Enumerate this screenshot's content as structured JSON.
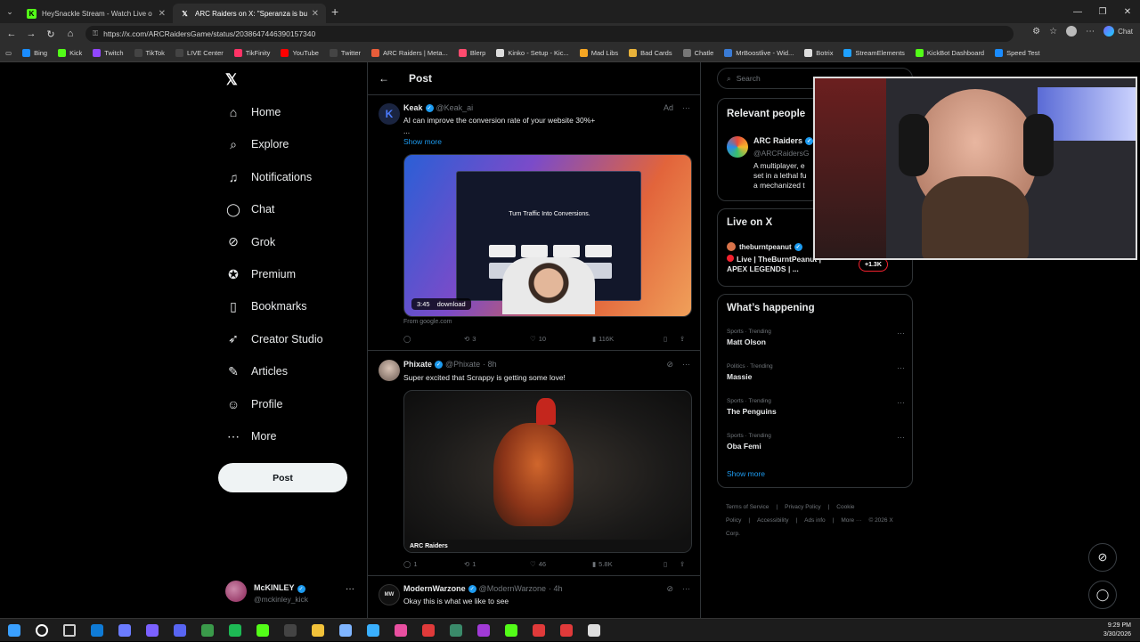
{
  "browser": {
    "tabs": [
      {
        "title": "HeySnackle Stream - Watch Live o",
        "icon": "kick-icon",
        "color": "#53fc18",
        "active": false
      },
      {
        "title": "ARC Raiders on X: \"Speranza is bu",
        "icon": "x-icon",
        "color": "#ffffff",
        "active": true
      }
    ],
    "url": "https://x.com/ARCRaidersGame/status/2038647446390157340",
    "chat_label": "Chat",
    "bookmarks": [
      {
        "label": "Bing",
        "color": "#1a8cff"
      },
      {
        "label": "Kick",
        "color": "#53fc18"
      },
      {
        "label": "Twitch",
        "color": "#9146ff"
      },
      {
        "label": "TikTok",
        "color": "#444444"
      },
      {
        "label": "LIVE Center",
        "color": "#444444"
      },
      {
        "label": "TikFinity",
        "color": "#ff3366"
      },
      {
        "label": "YouTube",
        "color": "#ff0000"
      },
      {
        "label": "Twitter",
        "color": "#444444"
      },
      {
        "label": "ARC Raiders | Meta...",
        "color": "#e85d3a"
      },
      {
        "label": "Blerp",
        "color": "#ff4b6e"
      },
      {
        "label": "Kinko - Setup - Kic...",
        "color": "#dddddd"
      },
      {
        "label": "Mad Libs",
        "color": "#f5a623"
      },
      {
        "label": "Bad Cards",
        "color": "#e8b23a"
      },
      {
        "label": "Chatle",
        "color": "#777777"
      },
      {
        "label": "MrBoostlive - Wid...",
        "color": "#3a7bd5"
      },
      {
        "label": "Botrix",
        "color": "#dddddd"
      },
      {
        "label": "StreamElements",
        "color": "#1ea0ff"
      },
      {
        "label": "KickBot Dashboard",
        "color": "#53fc18"
      },
      {
        "label": "Speed Test",
        "color": "#1a8cff"
      }
    ]
  },
  "nav": {
    "items": [
      {
        "label": "Home",
        "icon": "home-icon",
        "glyph": "⌂"
      },
      {
        "label": "Explore",
        "icon": "search-icon",
        "glyph": "⌕"
      },
      {
        "label": "Notifications",
        "icon": "bell-icon",
        "glyph": "♫"
      },
      {
        "label": "Chat",
        "icon": "chat-icon",
        "glyph": "◯"
      },
      {
        "label": "Grok",
        "icon": "grok-icon",
        "glyph": "⊘"
      },
      {
        "label": "Premium",
        "icon": "premium-icon",
        "glyph": "✪"
      },
      {
        "label": "Bookmarks",
        "icon": "bookmark-icon",
        "glyph": "▯"
      },
      {
        "label": "Creator Studio",
        "icon": "rocket-icon",
        "glyph": "➶"
      },
      {
        "label": "Articles",
        "icon": "article-icon",
        "glyph": "✎"
      },
      {
        "label": "Profile",
        "icon": "profile-icon",
        "glyph": "☺"
      },
      {
        "label": "More",
        "icon": "more-icon",
        "glyph": "⋯"
      }
    ],
    "post_label": "Post",
    "me": {
      "name": "McKINLEY",
      "handle": "@mckinley_kick"
    }
  },
  "main": {
    "title": "Post",
    "tweets": [
      {
        "name": "Keak",
        "handle": "@Keak_ai",
        "meta": "",
        "ad": "Ad",
        "text": "AI can improve the conversion rate of your website 30%+",
        "ellipsis": "...",
        "show_more": "Show more",
        "video_title": "Turn Traffic Into Conversions.",
        "duration": "3:45",
        "video_action": "download",
        "source": "From google.com",
        "replies": "",
        "reposts": "3",
        "likes": "10",
        "views": "116K"
      },
      {
        "name": "Phixate",
        "handle": "@Phixate",
        "meta": "· 8h",
        "text": "Super excited that Scrappy is getting some love!",
        "watermark": "ARC Raiders",
        "replies": "1",
        "reposts": "1",
        "likes": "46",
        "views": "5.8K"
      },
      {
        "name": "ModernWarzone",
        "handle": "@ModernWarzone",
        "meta": "· 4h",
        "text": "Okay this is what we like to see"
      }
    ]
  },
  "sidebar": {
    "search_placeholder": "Search",
    "relevant": {
      "title": "Relevant people",
      "name": "ARC Raiders",
      "handle": "@ARCRaidersG",
      "bio1": "A multiplayer, e",
      "bio2": "set in a lethal fu",
      "bio3": "a mechanized t"
    },
    "live": {
      "title": "Live on X",
      "host": "theburntpeanut",
      "stream": "Live | TheBurntPeanut |",
      "stream2": "APEX LEGENDS | ...",
      "count": "+1.3K"
    },
    "happening": {
      "title": "What’s happening",
      "trends": [
        {
          "cat": "Sports · Trending",
          "name": "Matt Olson"
        },
        {
          "cat": "Politics · Trending",
          "name": "Massie"
        },
        {
          "cat": "Sports · Trending",
          "name": "The Penguins"
        },
        {
          "cat": "Sports · Trending",
          "name": "Oba Femi"
        }
      ],
      "show_more": "Show more"
    },
    "footer": [
      "Terms of Service",
      "|",
      "Privacy Policy",
      "|",
      "Cookie Policy",
      "|",
      "Accessibility",
      "|",
      "Ads info",
      "|",
      "More ···",
      "© 2026 X Corp."
    ]
  },
  "taskbar": {
    "time": "9:29 PM",
    "date": "3/30/2026"
  }
}
